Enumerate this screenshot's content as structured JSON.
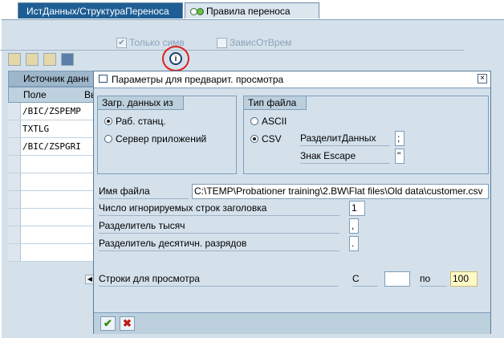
{
  "tabs": [
    "ИстДанных/СтруктураПереноса",
    "Правила переноса"
  ],
  "checkboxes": {
    "only_symbols": "Только симв",
    "time_dep": "ЗависОтВрем",
    "check_mark": "✔"
  },
  "source_table": {
    "header": "Источник данн",
    "columns": [
      "Поле",
      "Вь"
    ],
    "rows": [
      "/BIC/ZSPEMP",
      "TXTLG",
      "/BIC/ZSPGRI"
    ]
  },
  "dialog": {
    "title": "Параметры для предварит. просмотра",
    "load_from": {
      "title": "Загр. данных из",
      "options": [
        "Раб. станц.",
        "Сервер приложений"
      ],
      "selected": "Раб. станц."
    },
    "file_type": {
      "title": "Тип файла",
      "options": [
        "ASCII",
        "CSV"
      ],
      "selected": "CSV",
      "separator_label": "РазделитДанных",
      "separator_value": ";",
      "escape_label": "Знак Escape",
      "escape_value": "\""
    },
    "file_name_label": "Имя файла",
    "file_name_value": "C:\\TEMP\\Probationer training\\2.BW\\Flat files\\Old data\\customer.csv",
    "header_rows_label": "Число игнорируемых строк заголовка",
    "header_rows_value": "1",
    "thousands_label": "Разделитель тысяч",
    "thousands_value": ",",
    "decimal_label": "Разделитель десятичн. разрядов",
    "decimal_value": ".",
    "preview_rows_label": "Строки для просмотра",
    "from_label": "С",
    "from_value": "",
    "to_label": "по",
    "to_value": "100",
    "ok_glyph": "✔",
    "cancel_glyph": "✖"
  },
  "colors": {
    "accent": "#1e5e94",
    "background": "#d4e1eb",
    "highlight": "#e02020"
  }
}
